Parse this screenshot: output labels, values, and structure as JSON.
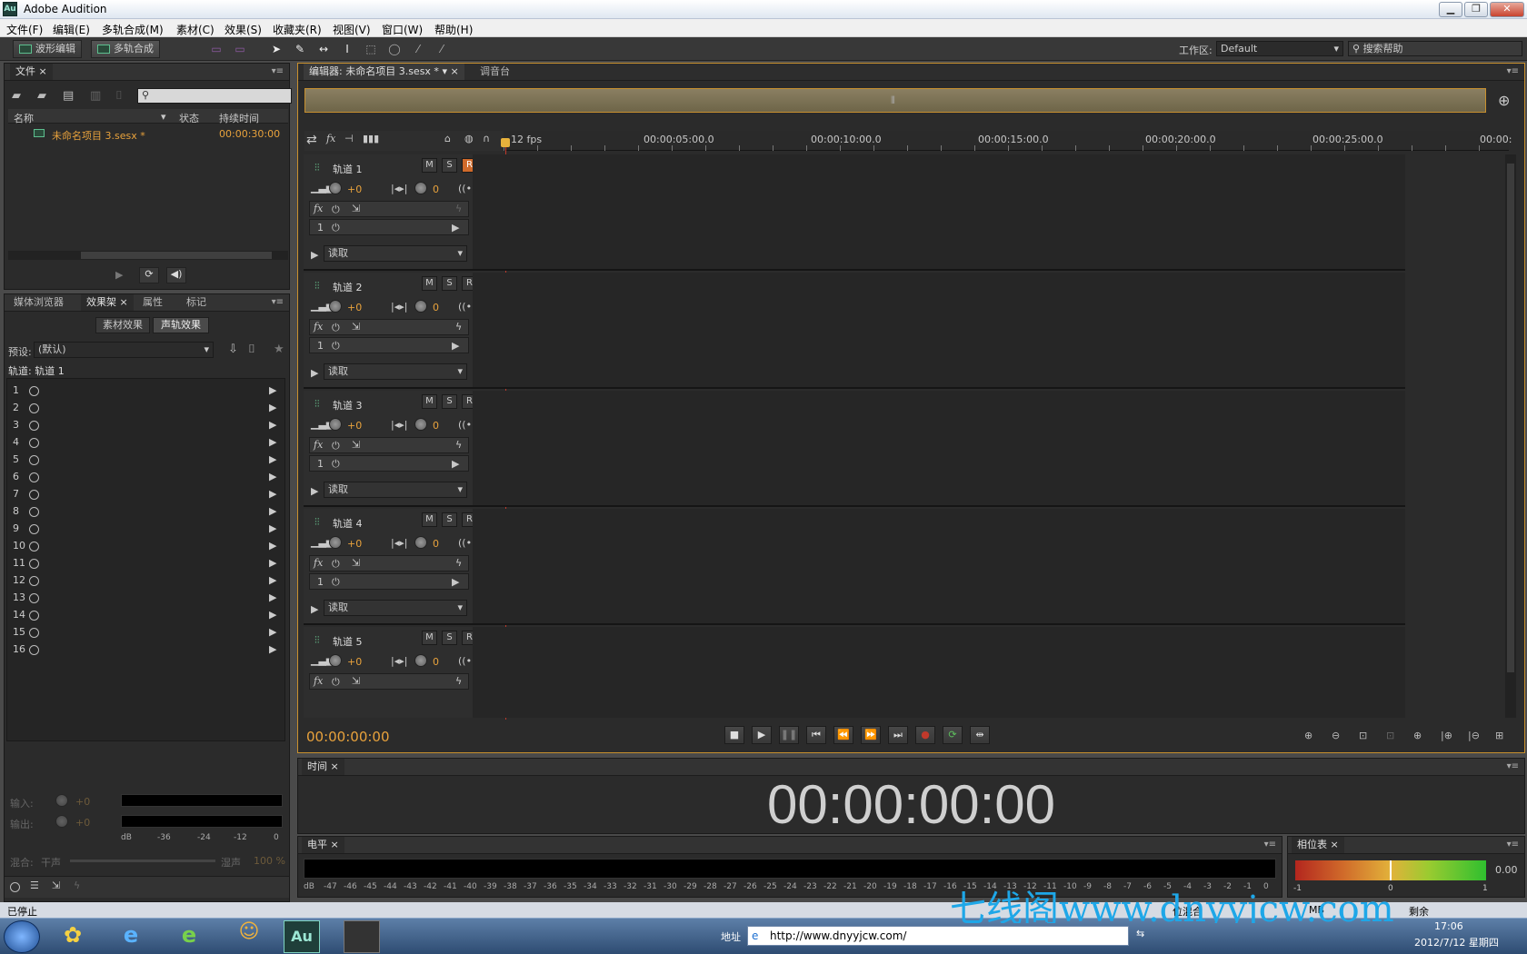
{
  "window": {
    "title": "Adobe Audition",
    "logo": "Au"
  },
  "menu": [
    "文件(F)",
    "编辑(E)",
    "多轨合成(M)",
    "素材(C)",
    "效果(S)",
    "收藏夹(R)",
    "视图(V)",
    "窗口(W)",
    "帮助(H)"
  ],
  "toolbar": {
    "waveform_label": "波形编辑",
    "multitrack_label": "多轨合成",
    "workspace_label": "工作区:",
    "workspace_value": "Default",
    "search_placeholder": "搜索帮助"
  },
  "files_panel": {
    "tab": "文件",
    "col_name": "名称",
    "col_status": "状态",
    "col_duration": "持续时间",
    "items": [
      {
        "name": "未命名项目 3.sesx *",
        "duration": "00:00:30:00"
      }
    ]
  },
  "effects_panel": {
    "tabs": [
      "媒体浏览器",
      "效果架",
      "属性",
      "标记"
    ],
    "btn_clip": "素材效果",
    "btn_track": "声轨效果",
    "preset_label": "预设:",
    "preset_value": "(默认)",
    "track_label": "轨道: 轨道 1",
    "slots": [
      "1",
      "2",
      "3",
      "4",
      "5",
      "6",
      "7",
      "8",
      "9",
      "10",
      "11",
      "12",
      "13",
      "14",
      "15",
      "16"
    ],
    "input_label": "输入:",
    "input_value": "+0",
    "output_label": "输出:",
    "output_value": "+0",
    "mix_label": "混合:",
    "dry_label": "干声",
    "wet_label": "湿声",
    "mix_value": "100 %",
    "db_ticks": [
      "dB",
      "-36",
      "-24",
      "-12",
      "0"
    ]
  },
  "editor": {
    "tab": "编辑器: 未命名项目 3.sesx *",
    "mixer_tab": "调音台",
    "fps": "12 fps",
    "ruler": [
      "00:00:05:00.0",
      "00:00:10:00.0",
      "00:00:15:00.0",
      "00:00:20:00.0",
      "00:00:25:00.0",
      "00:00:"
    ],
    "current_time": "00:00:00:00"
  },
  "tracks": [
    {
      "name": "轨道 1",
      "vol": "+0",
      "pan": "0",
      "slot": "1",
      "mode": "读取",
      "rec_armed": true
    },
    {
      "name": "轨道 2",
      "vol": "+0",
      "pan": "0",
      "slot": "1",
      "mode": "读取",
      "rec_armed": false
    },
    {
      "name": "轨道 3",
      "vol": "+0",
      "pan": "0",
      "slot": "1",
      "mode": "读取",
      "rec_armed": false
    },
    {
      "name": "轨道 4",
      "vol": "+0",
      "pan": "0",
      "slot": "1",
      "mode": "读取",
      "rec_armed": false
    },
    {
      "name": "轨道 5",
      "vol": "+0",
      "pan": "0",
      "slot": "",
      "mode": "",
      "rec_armed": false
    }
  ],
  "msr": {
    "m": "M",
    "s": "S",
    "r": "R",
    "i": "I"
  },
  "time_panel": {
    "tab": "时间",
    "display": "00:00:00:00"
  },
  "level_panel": {
    "tab": "电平",
    "ticks": [
      "dB",
      "-47",
      "-46",
      "-45",
      "-44",
      "-43",
      "-42",
      "-41",
      "-40",
      "-39",
      "-38",
      "-37",
      "-36",
      "-35",
      "-34",
      "-33",
      "-32",
      "-31",
      "-30",
      "-29",
      "-28",
      "-27",
      "-26",
      "-25",
      "-24",
      "-23",
      "-22",
      "-21",
      "-20",
      "-19",
      "-18",
      "-17",
      "-16",
      "-15",
      "-14",
      "-13",
      "-12",
      "-11",
      "-10",
      "-9",
      "-8",
      "-7",
      "-6",
      "-5",
      "-4",
      "-3",
      "-2",
      "-1",
      "0"
    ]
  },
  "phase_panel": {
    "tab": "相位表",
    "value": "0.00",
    "ticks": [
      "-1",
      "0",
      "1"
    ]
  },
  "status": {
    "text": "已停止",
    "right": "位混合",
    "mem": "MB",
    "remain": "剩余"
  },
  "taskbar": {
    "address_label": "地址",
    "url": "http://www.dnyyjcw.com/",
    "time": "17:06",
    "date": "2012/7/12 星期四"
  },
  "watermark": "七线阁www.dnyyjcw.com",
  "colors": {
    "accent": "#e8a23c",
    "rec": "#d06a2a",
    "meter_green": "#3fbf3f",
    "time_text": "#dcdcdc"
  }
}
